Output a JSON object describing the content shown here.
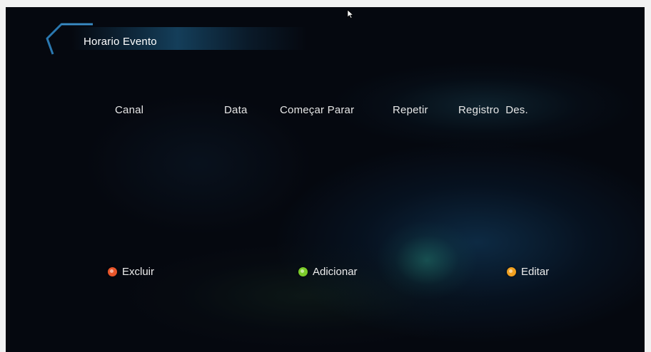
{
  "title": "Horario Evento",
  "columns": {
    "canal": "Canal",
    "data": "Data",
    "comecar_parar": "Começar Parar",
    "repetir": "Repetir",
    "registro_des": "Registro  Des."
  },
  "buttons": {
    "excluir": {
      "label": "Excluir",
      "color": "#e8552a"
    },
    "adicionar": {
      "label": "Adicionar",
      "color": "#7ccc2a"
    },
    "editar": {
      "label": "Editar",
      "color": "#f0a020"
    }
  },
  "colors": {
    "background": "#05080f",
    "accent": "#1f5f8a",
    "text": "#e6e6e6"
  }
}
